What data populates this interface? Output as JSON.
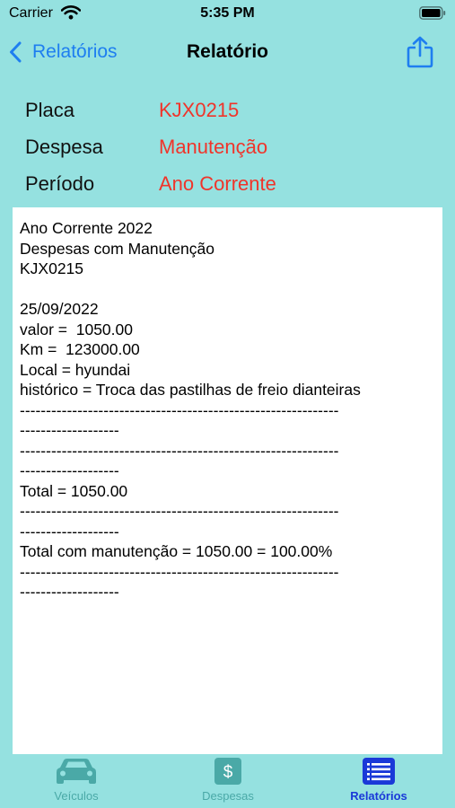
{
  "status_bar": {
    "carrier": "Carrier",
    "time": "5:35 PM"
  },
  "nav": {
    "back_label": "Relatórios",
    "title": "Relatório"
  },
  "info": {
    "rows": [
      {
        "label": "Placa",
        "value": "KJX0215"
      },
      {
        "label": "Despesa",
        "value": "Manutenção"
      },
      {
        "label": "Período",
        "value": "Ano Corrente"
      }
    ]
  },
  "report": {
    "text": "Ano Corrente 2022\nDespesas com Manutenção\nKJX0215\n\n25/09/2022\nvalor =  1050.00\nKm =  123000.00\nLocal = hyundai\nhistórico = Troca das pastilhas de freio dianteiras\n-------------------------------------------------------------\n-------------------\n-------------------------------------------------------------\n-------------------\nTotal = 1050.00\n-------------------------------------------------------------\n-------------------\nTotal com manutenção = 1050.00 = 100.00%\n-------------------------------------------------------------\n-------------------"
  },
  "tabs": [
    {
      "label": "Veículos",
      "icon": "car-icon"
    },
    {
      "label": "Despesas",
      "icon": "dollar-icon"
    },
    {
      "label": "Relatórios",
      "icon": "list-icon"
    }
  ],
  "colors": {
    "background": "#95e1e0",
    "accent_blue": "#1e7ef0",
    "value_red": "#f0342a",
    "tab_inactive": "#4aa9a7",
    "tab_active": "#1a39d8"
  }
}
